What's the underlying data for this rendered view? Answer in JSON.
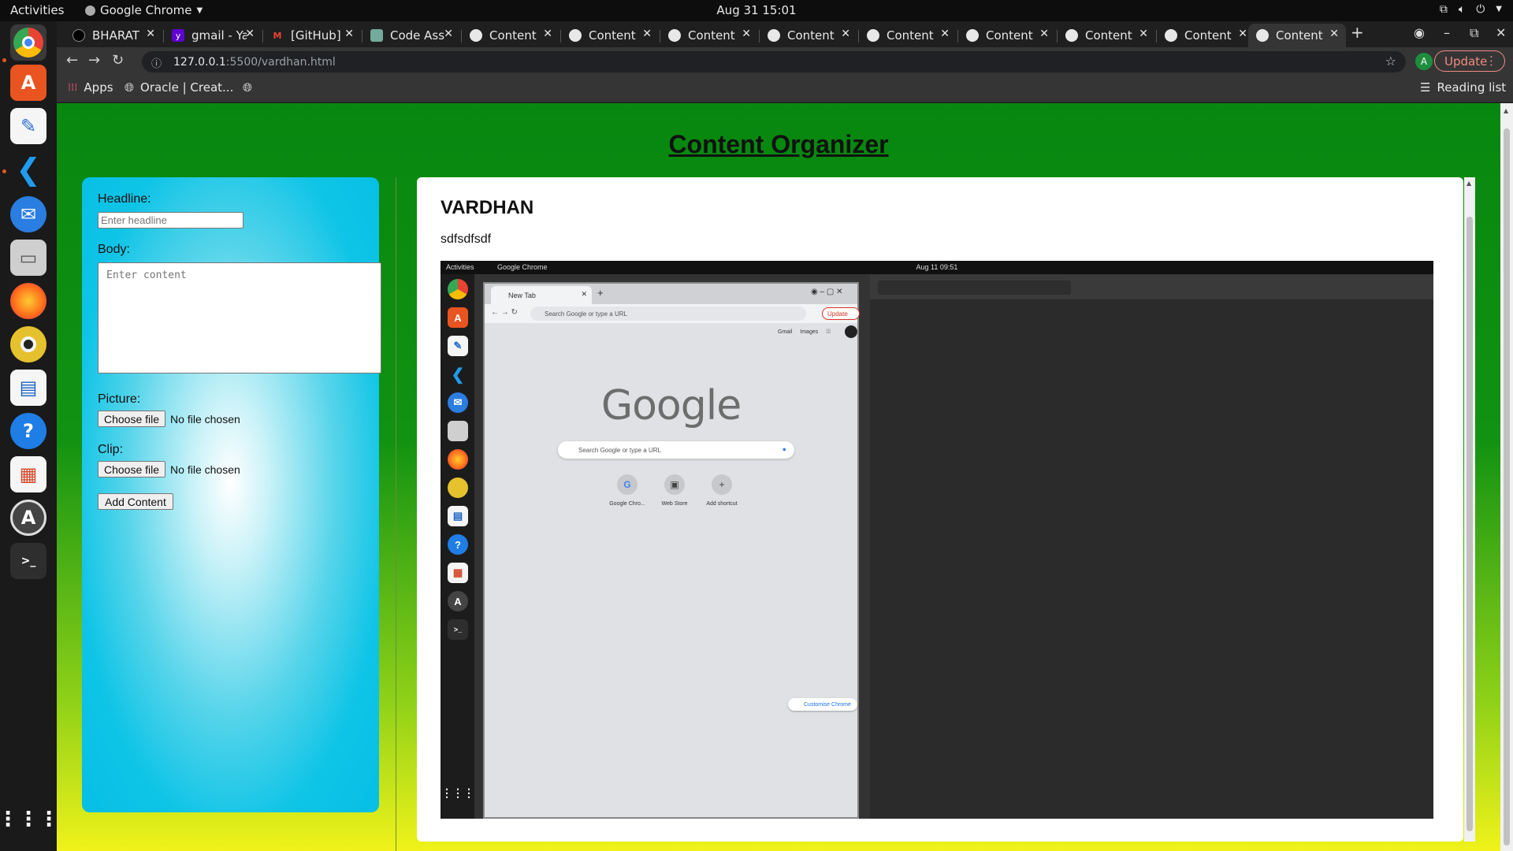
{
  "system": {
    "activities": "Activities",
    "app_name": "Google Chrome",
    "clock": "Aug 31  15:01"
  },
  "browser": {
    "tabs": [
      {
        "label": "BHARAT",
        "favicon": "github-icon"
      },
      {
        "label": "gmail - Ya",
        "favicon": "yahoo-icon"
      },
      {
        "label": "[GitHub]",
        "favicon": "gmail-icon"
      },
      {
        "label": "Code Ass",
        "favicon": "openai-icon"
      },
      {
        "label": "Content",
        "favicon": "globe-icon"
      },
      {
        "label": "Content",
        "favicon": "globe-icon"
      },
      {
        "label": "Content",
        "favicon": "globe-icon"
      },
      {
        "label": "Content",
        "favicon": "globe-icon"
      },
      {
        "label": "Content",
        "favicon": "globe-icon"
      },
      {
        "label": "Content",
        "favicon": "globe-icon"
      },
      {
        "label": "Content",
        "favicon": "globe-icon"
      },
      {
        "label": "Content",
        "favicon": "globe-icon"
      },
      {
        "label": "Content",
        "favicon": "globe-icon"
      }
    ],
    "url_host": "127.0.0.1",
    "url_path": ":5500/vardhan.html",
    "profile_initial": "A",
    "update_label": "Update",
    "bookmarks": {
      "apps": "Apps",
      "oracle": "Oracle | Creat...",
      "reading_list": "Reading list"
    }
  },
  "page": {
    "title": "Content Organizer",
    "form": {
      "headline_label": "Headline:",
      "headline_placeholder": "Enter headline",
      "body_label": "Body:",
      "body_placeholder": "Enter content",
      "picture_label": "Picture:",
      "clip_label": "Clip:",
      "choose_file": "Choose file",
      "no_file": "No file chosen",
      "add_button": "Add Content"
    },
    "entry": {
      "headline": "VARDHAN",
      "body": "sdfsdfsdf",
      "image": {
        "activities": "Activities",
        "app_name": "Google Chrome",
        "clock": "Aug 11  09:51",
        "tab_title": "New Tab",
        "omnibox_placeholder": "Search Google or type a URL",
        "update_label": "Update",
        "links": [
          "Gmail",
          "Images"
        ],
        "logo": "Google",
        "search_placeholder": "Search Google or type a URL",
        "shortcuts": [
          "Google Chro...",
          "Web Store",
          "Add shortcut"
        ],
        "customise": "Customise Chrome"
      }
    }
  },
  "colors": {
    "page_gradient_top": "#07870f",
    "page_gradient_bottom": "#f0f21a",
    "form_panel": "#06bfe5",
    "update_accent": "#f28b82"
  }
}
